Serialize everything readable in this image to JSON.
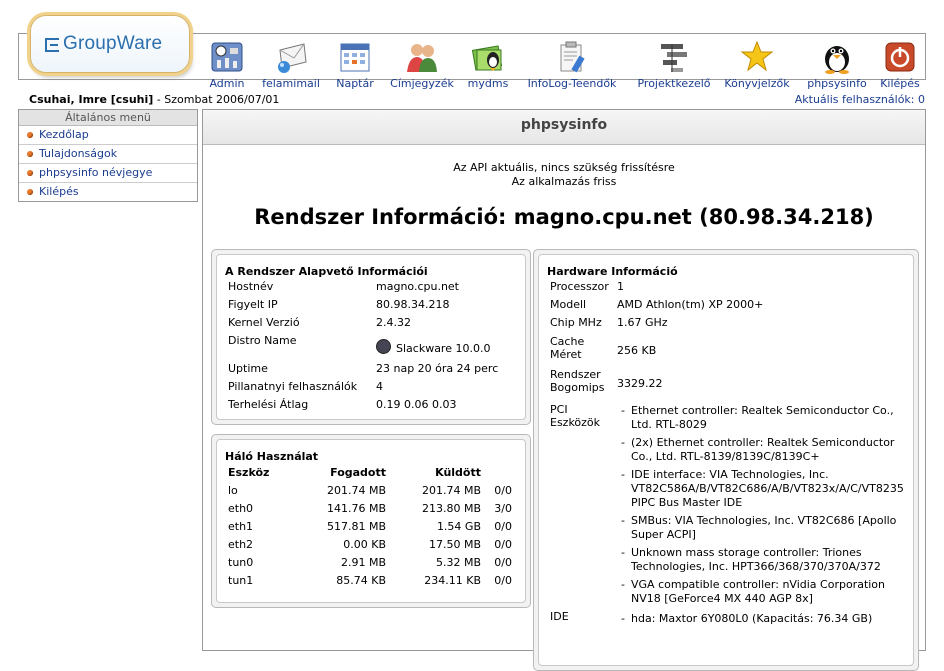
{
  "logo": {
    "text": "GroupWare"
  },
  "apps": [
    {
      "label": "Admin",
      "icon": "admin-icon"
    },
    {
      "label": "felamimail",
      "icon": "mail-icon"
    },
    {
      "label": "Naptár",
      "icon": "calendar-icon"
    },
    {
      "label": "Címjegyzék",
      "icon": "addressbook-icon"
    },
    {
      "label": "mydms",
      "icon": "documents-icon"
    },
    {
      "label": "InfoLog-Teendők",
      "icon": "infolog-icon"
    },
    {
      "label": "Projektkezelő",
      "icon": "project-icon"
    },
    {
      "label": "Könyvjelzők",
      "icon": "star-icon"
    },
    {
      "label": "phpsysinfo",
      "icon": "penguin-icon"
    },
    {
      "label": "Kilépés",
      "icon": "power-icon"
    }
  ],
  "user": {
    "name": "Csuhai, Imre [csuhi]",
    "date": " - Szombat 2006/07/01",
    "active_users": "Aktuális felhasználók: 0"
  },
  "sidebar": {
    "header": "Általános menü",
    "items": [
      "Kezdőlap",
      "Tulajdonságok",
      "phpsysinfo névjegye",
      "Kilépés"
    ]
  },
  "main": {
    "title": "phpsysinfo",
    "msg1": "Az API aktuális, nincs szükség frissítésre",
    "msg2": "Az alkalmazás friss",
    "heading": "Rendszer Információ: magno.cpu.net (80.98.34.218)"
  },
  "system": {
    "title": "A Rendszer Alapvető Információi",
    "rows": [
      {
        "k": "Hostnév",
        "v": "magno.cpu.net"
      },
      {
        "k": "Figyelt IP",
        "v": "80.98.34.218"
      },
      {
        "k": "Kernel Verzió",
        "v": "2.4.32"
      },
      {
        "k": "Distro Name",
        "v": "Slackware 10.0.0"
      },
      {
        "k": "Uptime",
        "v": "23 nap 20 óra 24 perc"
      },
      {
        "k": "Pillanatnyi felhasználók",
        "v": "4"
      },
      {
        "k": "Terhelési Átlag",
        "v": "0.19 0.06 0.03"
      }
    ]
  },
  "network": {
    "title": "Háló Használat",
    "headers": [
      "Eszköz",
      "Fogadott",
      "Küldött"
    ],
    "rows": [
      [
        "lo",
        "201.74 MB",
        "201.74 MB",
        "0/0"
      ],
      [
        "eth0",
        "141.76 MB",
        "213.80 MB",
        "3/0"
      ],
      [
        "eth1",
        "517.81 MB",
        "1.54 GB",
        "0/0"
      ],
      [
        "eth2",
        "0.00 KB",
        "17.50 MB",
        "0/0"
      ],
      [
        "tun0",
        "2.91 MB",
        "5.32 MB",
        "0/0"
      ],
      [
        "tun1",
        "85.74 KB",
        "234.11 KB",
        "0/0"
      ]
    ]
  },
  "hardware": {
    "title": "Hardware Információ",
    "rows": [
      {
        "k": "Processzor",
        "v": "1"
      },
      {
        "k": "Modell",
        "v": "AMD Athlon(tm) XP 2000+"
      },
      {
        "k": "Chip MHz",
        "v": "1.67 GHz"
      },
      {
        "k1": "Cache",
        "k2": "Méret",
        "v": "256 KB"
      },
      {
        "k1": "Rendszer",
        "k2": "Bogomips",
        "v": "3329.22"
      }
    ],
    "pci_label1": "PCI",
    "pci_label2": "Eszközök",
    "pci": [
      "Ethernet controller: Realtek Semiconductor Co., Ltd. RTL-8029",
      "(2x) Ethernet controller: Realtek Semiconductor Co., Ltd. RTL-8139/8139C/8139C+",
      "IDE interface: VIA Technologies, Inc. VT82C586A/B/VT82C686/A/B/VT823x/A/C/VT8235 PIPC Bus Master IDE",
      "SMBus: VIA Technologies, Inc. VT82C686 [Apollo Super ACPI]",
      "Unknown mass storage controller: Triones Technologies, Inc. HPT366/368/370/370A/372",
      "VGA compatible controller: nVidia Corporation NV18 [GeForce4 MX 440 AGP 8x]"
    ],
    "ide_label": "IDE",
    "ide": "hda: Maxtor 6Y080L0 (Kapacitás: 76.34 GB)"
  }
}
